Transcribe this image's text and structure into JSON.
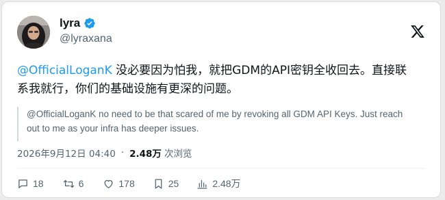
{
  "author": {
    "display_name": "lyra",
    "handle": "@lyraxana",
    "verified": true
  },
  "tweet": {
    "mention": "@OfficialLoganK",
    "text_line1": " 没必要因为怕我，就把GDM的API密钥全收回去。直接联",
    "text_line2": "系我就行，你们的基础设施有更深的问题。",
    "translation_line1": "@OfficialLoganK no need to be that scared of me by revoking all GDM API Keys. Just reach",
    "translation_line2": "out to me as your infra has deeper issues."
  },
  "meta": {
    "timestamp": "2026年9月12日 04:40",
    "separator": "·",
    "views_count": "2.48万",
    "views_label": "次浏览"
  },
  "actions": {
    "replies": "18",
    "reposts": "6",
    "likes": "178",
    "bookmarks": "25",
    "views": "2.48万"
  },
  "icons": {
    "logo": "x-logo-icon",
    "verified": "verified-badge-icon",
    "reply": "reply-icon",
    "repost": "repost-icon",
    "like": "heart-icon",
    "bookmark": "bookmark-icon",
    "views": "analytics-icon"
  },
  "colors": {
    "accent": "#1d9bf0",
    "secondary_text": "#536471",
    "primary_text": "#0f1419"
  }
}
